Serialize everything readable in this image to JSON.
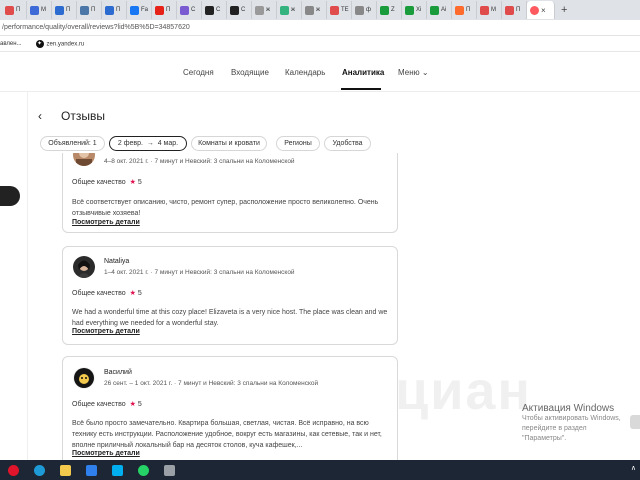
{
  "browser": {
    "tabs": [
      {
        "label": "П",
        "color": "#e04c4c"
      },
      {
        "label": "М",
        "color": "#3d6ad6"
      },
      {
        "label": "П",
        "color": "#2c6bd0"
      },
      {
        "label": "П",
        "color": "#4a76a8"
      },
      {
        "label": "П",
        "color": "#2c6bd0"
      },
      {
        "label": "Fa",
        "color": "#1877f2"
      },
      {
        "label": "П",
        "color": "#e62117"
      },
      {
        "label": "С",
        "color": "#7a5bd1"
      },
      {
        "label": "С",
        "color": "#222222"
      },
      {
        "label": "С",
        "color": "#222222"
      },
      {
        "label": "ж",
        "color": "#999999"
      },
      {
        "label": "ж",
        "color": "#35b37e"
      },
      {
        "label": "ж",
        "color": "#888888"
      },
      {
        "label": "TE",
        "color": "#e04c4c"
      },
      {
        "label": "ф",
        "color": "#888888"
      },
      {
        "label": "Z",
        "color": "#1a9c3c"
      },
      {
        "label": "Xi",
        "color": "#1a9c3c"
      },
      {
        "label": "Ai",
        "color": "#1a9c3c"
      },
      {
        "label": "П",
        "color": "#ff6b2c"
      },
      {
        "label": "М",
        "color": "#e04c4c"
      },
      {
        "label": "П",
        "color": "#e04c4c"
      }
    ],
    "active_tab_color": "#ff5a5f",
    "url": "/performance/quality/overall/reviews?lid%5B%5D=34857620",
    "bookmarks": [
      {
        "label": "авлен...",
        "icon": ""
      },
      {
        "label": "zen.yandex.ru",
        "icon": "✦"
      }
    ]
  },
  "nav": {
    "items": [
      {
        "label": "Сегодня"
      },
      {
        "label": "Входящие"
      },
      {
        "label": "Календарь"
      },
      {
        "label": "Аналитика"
      },
      {
        "label": "Меню"
      }
    ],
    "menu_chevron": "⌄"
  },
  "page": {
    "back_icon": "‹",
    "title": "Отзывы"
  },
  "filters": {
    "listings": "Объявлений: 1",
    "date_from": "2 февр.",
    "date_arrow": "→",
    "date_to": "4 мар.",
    "rooms": "Комнаты и кровати",
    "regions": "Регионы",
    "amenities": "Удобства"
  },
  "reviews": [
    {
      "name": "",
      "meta": "4–8 окт. 2021 г. · 7 минут и Невский: 3 спальни на Коломенской",
      "quality_label": "Общее качество",
      "star": "★",
      "rating": "5",
      "text": "Всё соответствует описанию, чисто, ремонт супер, расположение просто великолепно. Очень отзывчивые хозяева!",
      "link": "Посмотреть детали"
    },
    {
      "name": "Nataliya",
      "meta": "1–4 окт. 2021 г. · 7 минут и Невский: 3 спальни на Коломенской",
      "quality_label": "Общее качество",
      "star": "★",
      "rating": "5",
      "text": "We had a wonderful time at this cozy place! Elizaveta is a very nice host. The place was clean and we had everything we needed for a wonderful stay.",
      "link": "Посмотреть детали"
    },
    {
      "name": "Василий",
      "meta": "26 сент. – 1 окт. 2021 г. · 7 минут и Невский: 3 спальни на Коломенской",
      "quality_label": "Общее качество",
      "star": "★",
      "rating": "5",
      "text": "Всё было просто замечательно. Квартира большая, светлая, чистая. Всё исправно, на всю технику есть инструкции. Расположение удобное, вокруг есть магазины, как сетевые, так и нет, вполне приличный локальный бар на десяток столов, куча кафешек,...",
      "link": "Посмотреть детали"
    }
  ],
  "watermark": "циан",
  "windows_activation": {
    "title": "Активация Windows",
    "line1": "Чтобы активировать Windows, перейдите в раздел",
    "line2": "\"Параметры\"."
  },
  "taskbar": {
    "icons": [
      {
        "name": "opera",
        "color": "#e0142a"
      },
      {
        "name": "edge",
        "color": "#1e9bd7"
      },
      {
        "name": "explorer",
        "color": "#f2c94c"
      },
      {
        "name": "calendar",
        "color": "#2f80ed"
      },
      {
        "name": "skype",
        "color": "#00aff0"
      },
      {
        "name": "whatsapp",
        "color": "#25d366"
      },
      {
        "name": "app",
        "color": "#9aa0a6"
      }
    ],
    "tray": "∧"
  }
}
